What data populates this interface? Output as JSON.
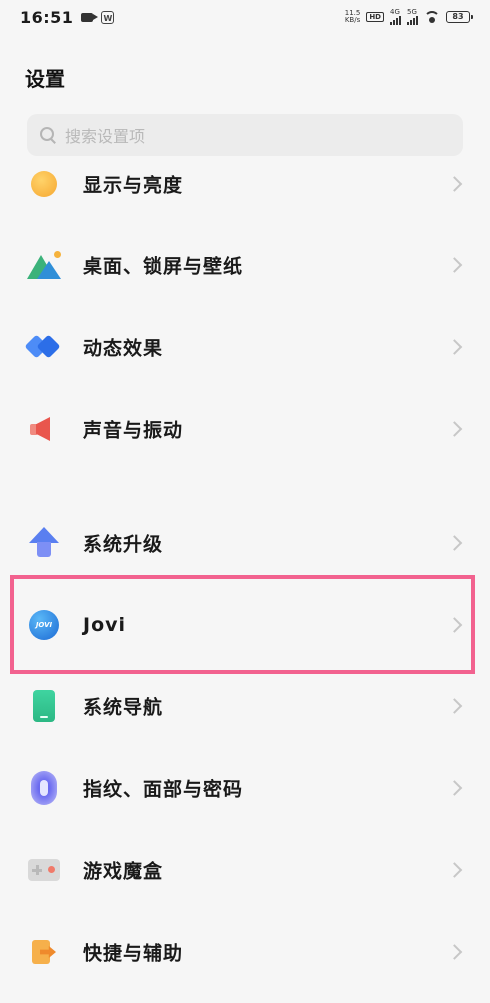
{
  "status_bar": {
    "time": "16:51",
    "net_speed_value": "11.5",
    "net_speed_unit": "KB/s",
    "hd_label": "HD",
    "signal1_label": "4G",
    "signal2_label": "5G",
    "battery": "83"
  },
  "page": {
    "title": "设置"
  },
  "search": {
    "placeholder": "搜索设置项"
  },
  "settings_items": [
    {
      "label": "显示与亮度",
      "icon": "display-brightness-icon"
    },
    {
      "label": "桌面、锁屏与壁纸",
      "icon": "wallpaper-icon"
    },
    {
      "label": "动态效果",
      "icon": "dynamic-effects-icon"
    },
    {
      "label": "声音与振动",
      "icon": "sound-icon"
    },
    {
      "label": "系统升级",
      "icon": "system-upgrade-icon"
    },
    {
      "label": "Jovi",
      "icon": "jovi-icon",
      "highlighted": true
    },
    {
      "label": "系统导航",
      "icon": "system-navigation-icon"
    },
    {
      "label": "指纹、面部与密码",
      "icon": "fingerprint-icon"
    },
    {
      "label": "游戏魔盒",
      "icon": "game-box-icon"
    },
    {
      "label": "快捷与辅助",
      "icon": "shortcuts-icon"
    }
  ],
  "jovi_icon_text": "JOVI",
  "colors": {
    "highlight_border": "#f2628f",
    "background": "#f6f6f6",
    "search_bg": "#ececec"
  }
}
